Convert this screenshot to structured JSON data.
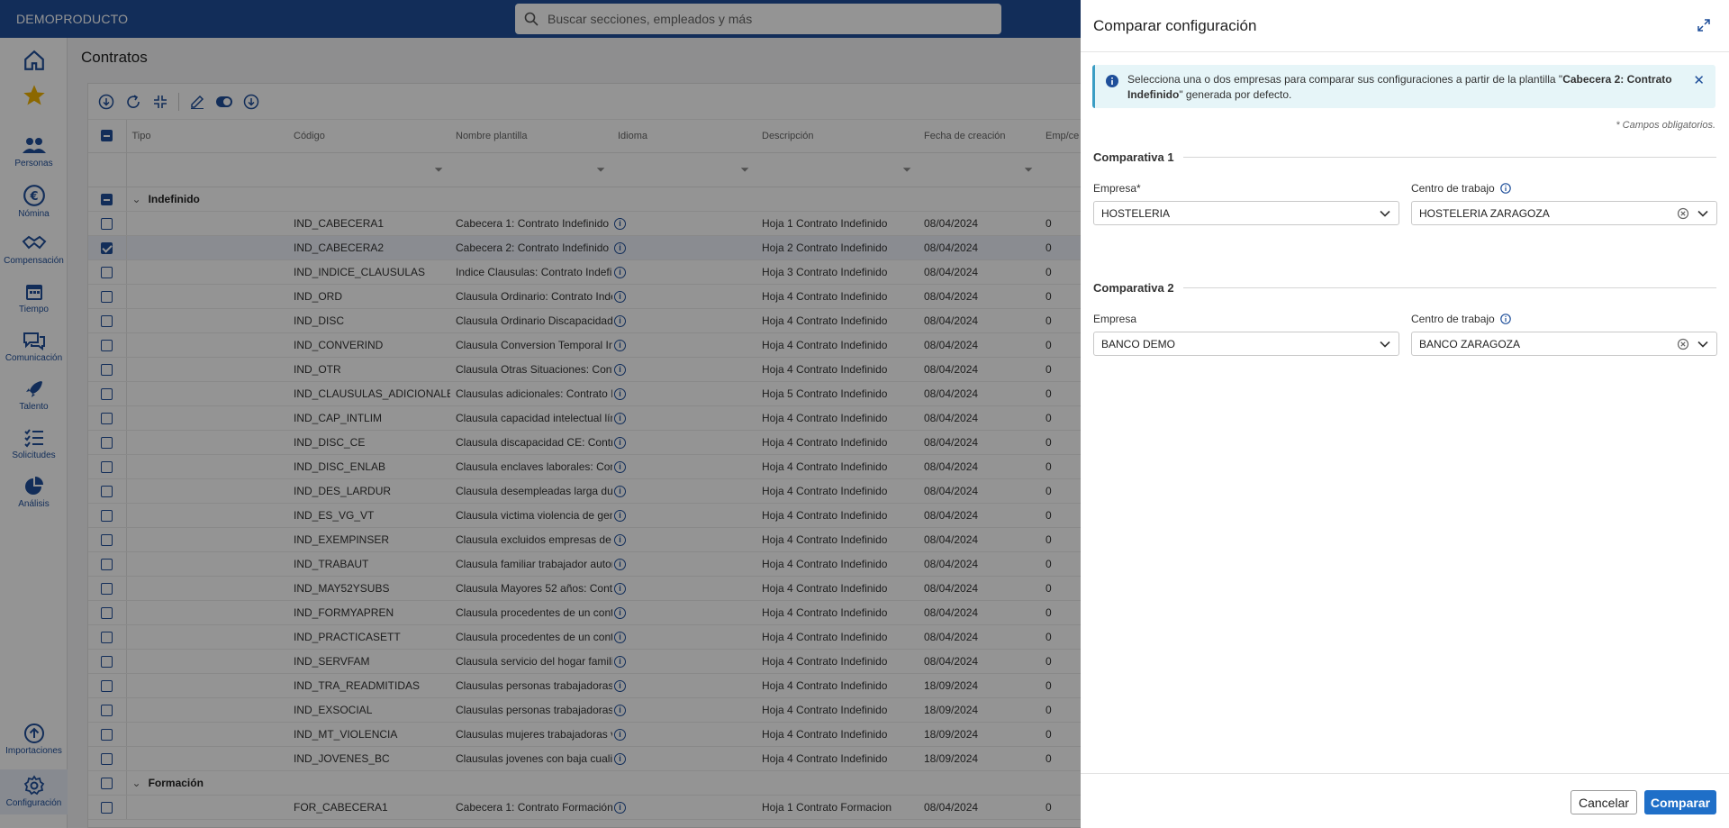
{
  "app": {
    "brand": "DEMOPRODUCTO"
  },
  "search": {
    "placeholder": "Buscar secciones, empleados y más"
  },
  "sidebar": {
    "items": [
      {
        "label": "",
        "icon": "home-icon"
      },
      {
        "label": "",
        "icon": "star-icon"
      },
      {
        "label": "Personas",
        "icon": "people-icon"
      },
      {
        "label": "Nómina",
        "icon": "euro-icon"
      },
      {
        "label": "Compensación",
        "icon": "handshake-icon"
      },
      {
        "label": "Tiempo",
        "icon": "calendar-icon"
      },
      {
        "label": "Comunicación",
        "icon": "chat-icon"
      },
      {
        "label": "Talento",
        "icon": "rocket-icon"
      },
      {
        "label": "Solicitudes",
        "icon": "list-icon"
      },
      {
        "label": "Análisis",
        "icon": "pie-icon"
      },
      {
        "label": "Importaciones",
        "icon": "upload-icon"
      },
      {
        "label": "Configuración",
        "icon": "gear-icon"
      }
    ]
  },
  "page": {
    "title": "Contratos"
  },
  "table": {
    "columns": [
      "Tipo",
      "Código",
      "Nombre plantilla",
      "Idioma",
      "Descripción",
      "Fecha de creación",
      "Emp/ce"
    ],
    "groups": [
      {
        "name": "Indefinido",
        "rows": [
          {
            "codigo": "IND_CABECERA1",
            "nombre": "Cabecera 1: Contrato Indefinido",
            "desc": "Hoja 1 Contrato Indefinido",
            "fecha": "08/04/2024",
            "emp": "0",
            "checked": false
          },
          {
            "codigo": "IND_CABECERA2",
            "nombre": "Cabecera 2: Contrato Indefinido",
            "desc": "Hoja 2 Contrato Indefinido",
            "fecha": "08/04/2024",
            "emp": "0",
            "checked": true
          },
          {
            "codigo": "IND_INDICE_CLAUSULAS",
            "nombre": "Indice Clausulas: Contrato Indefin",
            "desc": "Hoja 3 Contrato Indefinido",
            "fecha": "08/04/2024",
            "emp": "0",
            "checked": false
          },
          {
            "codigo": "IND_ORD",
            "nombre": "Clausula Ordinario: Contrato Inde",
            "desc": "Hoja 4 Contrato Indefinido",
            "fecha": "08/04/2024",
            "emp": "0",
            "checked": false
          },
          {
            "codigo": "IND_DISC",
            "nombre": "Clausula Ordinario Discapacidad:",
            "desc": "Hoja 4 Contrato Indefinido",
            "fecha": "08/04/2024",
            "emp": "0",
            "checked": false
          },
          {
            "codigo": "IND_CONVERIND",
            "nombre": "Clausula Conversion Temporal Ind",
            "desc": "Hoja 4 Contrato Indefinido",
            "fecha": "08/04/2024",
            "emp": "0",
            "checked": false
          },
          {
            "codigo": "IND_OTR",
            "nombre": "Clausula Otras Situaciones: Contr",
            "desc": "Hoja 4 Contrato Indefinido",
            "fecha": "08/04/2024",
            "emp": "0",
            "checked": false
          },
          {
            "codigo": "IND_CLAUSULAS_ADICIONALES",
            "nombre": "Clausulas adicionales: Contrato In",
            "desc": "Hoja 5 Contrato Indefinido",
            "fecha": "08/04/2024",
            "emp": "0",
            "checked": false
          },
          {
            "codigo": "IND_CAP_INTLIM",
            "nombre": "Clausula capacidad intelectual lín",
            "desc": "Hoja 4 Contrato Indefinido",
            "fecha": "08/04/2024",
            "emp": "0",
            "checked": false
          },
          {
            "codigo": "IND_DISC_CE",
            "nombre": "Clausula discapacidad CE: Contra",
            "desc": "Hoja 4 Contrato Indefinido",
            "fecha": "08/04/2024",
            "emp": "0",
            "checked": false
          },
          {
            "codigo": "IND_DISC_ENLAB",
            "nombre": "Clausula enclaves laborales: Cont",
            "desc": "Hoja 4 Contrato Indefinido",
            "fecha": "08/04/2024",
            "emp": "0",
            "checked": false
          },
          {
            "codigo": "IND_DES_LARDUR",
            "nombre": "Clausula desempleadas larga dur",
            "desc": "Hoja 4 Contrato Indefinido",
            "fecha": "08/04/2024",
            "emp": "0",
            "checked": false
          },
          {
            "codigo": "IND_ES_VG_VT",
            "nombre": "Clausula victima violencia de gen",
            "desc": "Hoja 4 Contrato Indefinido",
            "fecha": "08/04/2024",
            "emp": "0",
            "checked": false
          },
          {
            "codigo": "IND_EXEMPINSER",
            "nombre": "Clausula excluidos empresas de i",
            "desc": "Hoja 4 Contrato Indefinido",
            "fecha": "08/04/2024",
            "emp": "0",
            "checked": false
          },
          {
            "codigo": "IND_TRABAUT",
            "nombre": "Clausula familiar trabajador autor",
            "desc": "Hoja 4 Contrato Indefinido",
            "fecha": "08/04/2024",
            "emp": "0",
            "checked": false
          },
          {
            "codigo": "IND_MAY52YSUBS",
            "nombre": "Clausula Mayores 52 años: Contr",
            "desc": "Hoja 4 Contrato Indefinido",
            "fecha": "08/04/2024",
            "emp": "0",
            "checked": false
          },
          {
            "codigo": "IND_FORMYAPREN",
            "nombre": "Clausula procedentes de un contr",
            "desc": "Hoja 4 Contrato Indefinido",
            "fecha": "08/04/2024",
            "emp": "0",
            "checked": false
          },
          {
            "codigo": "IND_PRACTICASETT",
            "nombre": "Clausula procedentes de un contr",
            "desc": "Hoja 4 Contrato Indefinido",
            "fecha": "08/04/2024",
            "emp": "0",
            "checked": false
          },
          {
            "codigo": "IND_SERVFAM",
            "nombre": "Clausula servicio del hogar famili",
            "desc": "Hoja 4 Contrato Indefinido",
            "fecha": "08/04/2024",
            "emp": "0",
            "checked": false
          },
          {
            "codigo": "IND_TRA_READMITIDAS",
            "nombre": "Clausulas personas trabajadoras",
            "desc": "Hoja 4 Contrato Indefinido",
            "fecha": "18/09/2024",
            "emp": "0",
            "checked": false
          },
          {
            "codigo": "IND_EXSOCIAL",
            "nombre": "Clausulas personas trabajadoras",
            "desc": "Hoja 4 Contrato Indefinido",
            "fecha": "18/09/2024",
            "emp": "0",
            "checked": false
          },
          {
            "codigo": "IND_MT_VIOLENCIA",
            "nombre": "Clausulas mujeres trabajadoras v",
            "desc": "Hoja 4 Contrato Indefinido",
            "fecha": "18/09/2024",
            "emp": "0",
            "checked": false
          },
          {
            "codigo": "IND_JOVENES_BC",
            "nombre": "Clausulas jovenes con baja cualif",
            "desc": "Hoja 4 Contrato Indefinido",
            "fecha": "18/09/2024",
            "emp": "0",
            "checked": false
          }
        ]
      },
      {
        "name": "Formación",
        "rows": [
          {
            "codigo": "FOR_CABECERA1",
            "nombre": "Cabecera 1: Contrato Formación",
            "desc": "Hoja 1 Contrato Formacion",
            "fecha": "08/04/2024",
            "emp": "0",
            "checked": false
          }
        ]
      }
    ]
  },
  "panel": {
    "title": "Comparar configuración",
    "alert": {
      "text_pre": "Selecciona una o dos empresas para comparar sus configuraciones a partir de la plantilla \"",
      "bold": "Cabecera 2: Contrato Indefinido",
      "text_post": "\" generada por defecto."
    },
    "required_note": "* Campos obligatorios.",
    "comparativa1": {
      "title": "Comparativa 1",
      "empresa_label": "Empresa*",
      "empresa_value": "HOSTELERIA",
      "centro_label": "Centro de trabajo",
      "centro_value": "HOSTELERIA ZARAGOZA"
    },
    "comparativa2": {
      "title": "Comparativa 2",
      "empresa_label": "Empresa",
      "empresa_value": "BANCO DEMO",
      "centro_label": "Centro de trabajo",
      "centro_value": "BANCO ZARAGOZA"
    },
    "cancel_label": "Cancelar",
    "compare_label": "Comparar"
  },
  "colors": {
    "brand": "#1f4f9a",
    "primary_button": "#1f6fc8",
    "alert_bg": "#e6f5f8"
  }
}
